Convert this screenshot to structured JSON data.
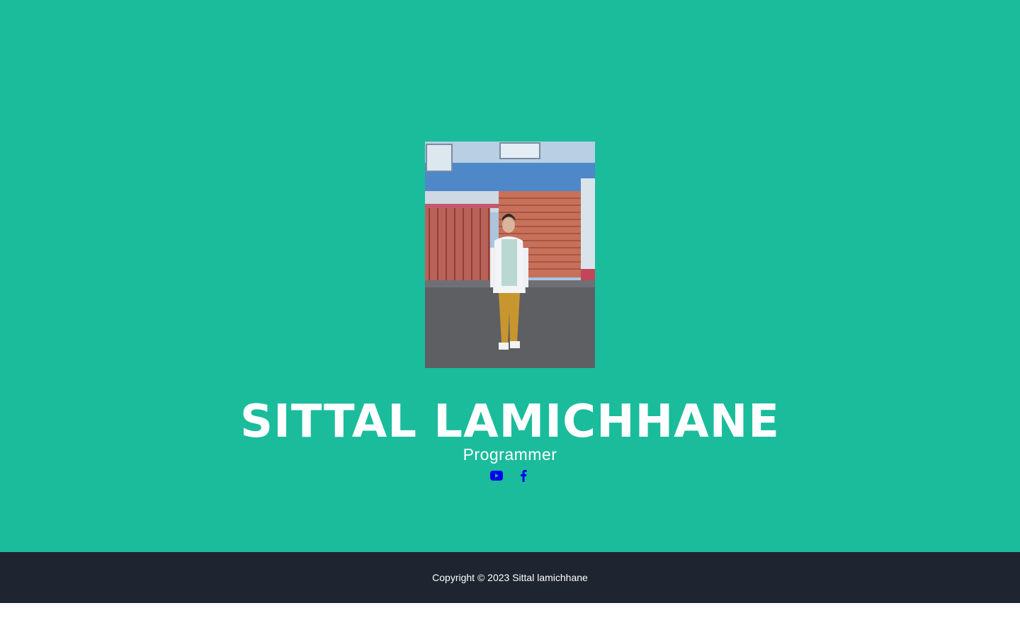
{
  "profile": {
    "name": "SITTAL LAMICHHANE",
    "role": "Programmer",
    "photo_alt": "Profile photo"
  },
  "social": [
    {
      "name": "youtube-icon",
      "color": "#0000ee"
    },
    {
      "name": "facebook-icon",
      "color": "#0000ee"
    }
  ],
  "footer": {
    "copyright": "Copyright © 2023 Sittal lamichhane"
  },
  "colors": {
    "masthead_bg": "#1abc9c",
    "footer_bg": "#1e2530",
    "text": "#ffffff",
    "link": "#0000ee"
  }
}
